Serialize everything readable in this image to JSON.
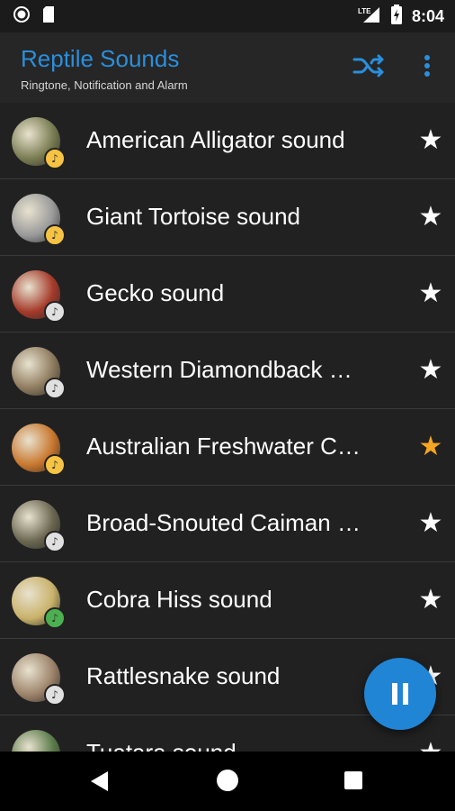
{
  "status_bar": {
    "time": "8:04",
    "network": "LTE",
    "icons": [
      "circle-notification-icon",
      "sd-card-icon",
      "signal-icon",
      "battery-charging-icon"
    ]
  },
  "app_bar": {
    "title": "Reptile Sounds",
    "subtitle": "Ringtone, Notification and Alarm",
    "actions": [
      "shuffle-icon",
      "more-vert-icon"
    ],
    "title_color": "#2a8fdc"
  },
  "sounds": [
    {
      "title": "American Alligator sound",
      "favorite": false,
      "badge_color": "#f6c343",
      "thumb_color": "#7a7d52"
    },
    {
      "title": "Giant Tortoise sound",
      "favorite": false,
      "badge_color": "#f6c343",
      "thumb_color": "#9a9a9a"
    },
    {
      "title": "Gecko sound",
      "favorite": false,
      "badge_color": "#e0e0e0",
      "thumb_color": "#a53a2a"
    },
    {
      "title": "Western Diamondback Rattlesnake sound",
      "favorite": false,
      "badge_color": "#e0e0e0",
      "thumb_color": "#8e7b5e"
    },
    {
      "title": "Australian Freshwater Crocodile sound",
      "favorite": true,
      "badge_color": "#f6c343",
      "thumb_color": "#c9772e"
    },
    {
      "title": "Broad-Snouted Caiman sound",
      "favorite": false,
      "badge_color": "#e0e0e0",
      "thumb_color": "#6a6650"
    },
    {
      "title": "Cobra Hiss sound",
      "favorite": false,
      "badge_color": "#4caf50",
      "thumb_color": "#c9b26a"
    },
    {
      "title": "Rattlesnake sound",
      "favorite": false,
      "badge_color": "#e0e0e0",
      "thumb_color": "#9c836a"
    },
    {
      "title": "Tuatara sound",
      "favorite": false,
      "badge_color": "#e0e0e0",
      "thumb_color": "#5b7b4a"
    }
  ],
  "colors": {
    "star_default": "#ffffff",
    "star_favorite": "#f5a623",
    "fab": "#2185d5"
  },
  "fab": {
    "icon": "pause-icon"
  },
  "nav_bar": {
    "buttons": [
      "back-icon",
      "home-icon",
      "recents-icon"
    ]
  }
}
